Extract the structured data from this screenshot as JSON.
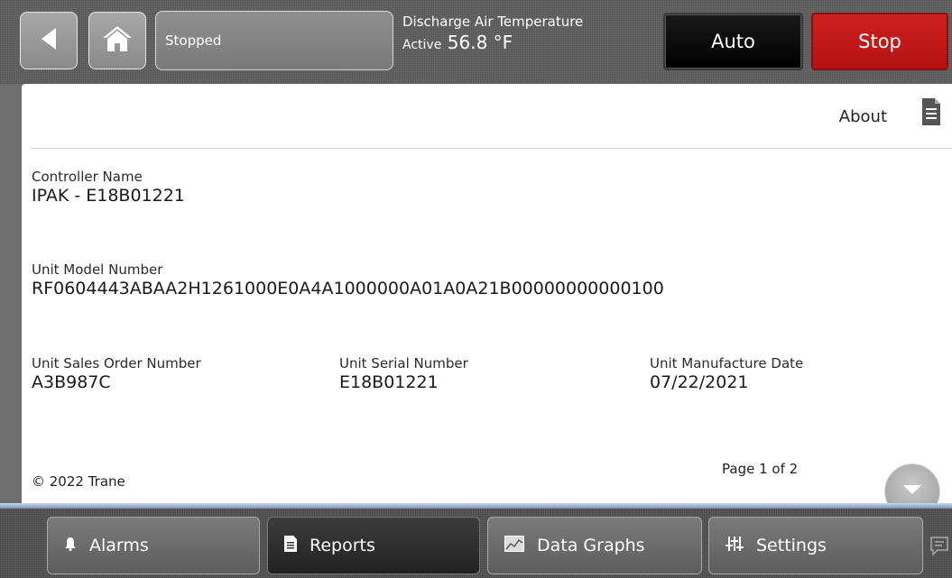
{
  "header": {
    "status_text": "Stopped",
    "dat_label": "Discharge Air Temperature",
    "dat_mode": "Active",
    "dat_value": "56.8 °F",
    "auto_label": "Auto",
    "stop_label": "Stop"
  },
  "page": {
    "title": "About",
    "fields": {
      "controller_name": {
        "label": "Controller Name",
        "value": "IPAK - E18B01221"
      },
      "model_number": {
        "label": "Unit Model Number",
        "value": "RF0604443ABAA2H1261000E0A4A1000000A01A0A21B00000000000100"
      },
      "sales_order": {
        "label": "Unit Sales Order Number",
        "value": "A3B987C"
      },
      "serial_number": {
        "label": "Unit Serial Number",
        "value": "E18B01221"
      },
      "manufacture_date": {
        "label": "Unit Manufacture Date",
        "value": "07/22/2021"
      }
    },
    "copyright": "© 2022 Trane",
    "page_info": "Page 1 of 2"
  },
  "nav": {
    "alarms": "Alarms",
    "reports": "Reports",
    "data_graphs": "Data Graphs",
    "settings": "Settings"
  },
  "colors": {
    "stop": "#c41a1a",
    "auto": "#0a0a0a",
    "nav_accent": "#9fb3d1"
  },
  "icons": {
    "back": "back-arrow-icon",
    "home": "home-icon",
    "about_doc": "document-icon",
    "next_page": "chevron-down-icon",
    "alarms": "bell-icon",
    "reports": "document-icon",
    "data_graphs": "chart-icon",
    "settings": "sliders-icon",
    "more": "chat-bubble-icon"
  }
}
